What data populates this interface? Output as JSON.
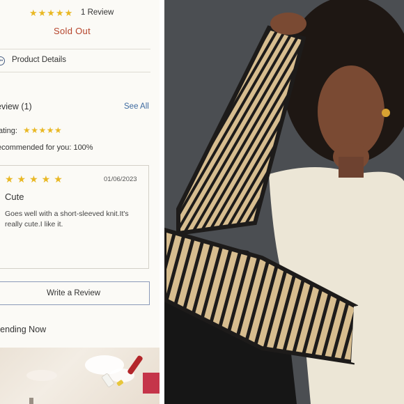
{
  "rating": {
    "stars": "★★★★★",
    "count_label": "1 Review"
  },
  "status": {
    "sold_out": "Sold Out"
  },
  "product_details": {
    "label": "Product Details",
    "icon": "ellipsis-circle-icon"
  },
  "reviews": {
    "heading": "eview (1)",
    "see_all": "See All",
    "rating_label": "ating:",
    "rating_stars": "★★★★★",
    "recommended": "ecommended for you: 100%",
    "items": [
      {
        "stars": "★★★★★",
        "date": "01/06/2023",
        "title": "Cute",
        "body": "Goes well with a short-sleeved knit.It's really cute.I like it."
      }
    ],
    "write_button": "Write a Review"
  },
  "trending": {
    "heading": "rending Now"
  },
  "colors": {
    "star": "#e9b824",
    "sold_out": "#b5432a",
    "link": "#3d6aa0",
    "panel_bg": "#fbfaf6"
  }
}
